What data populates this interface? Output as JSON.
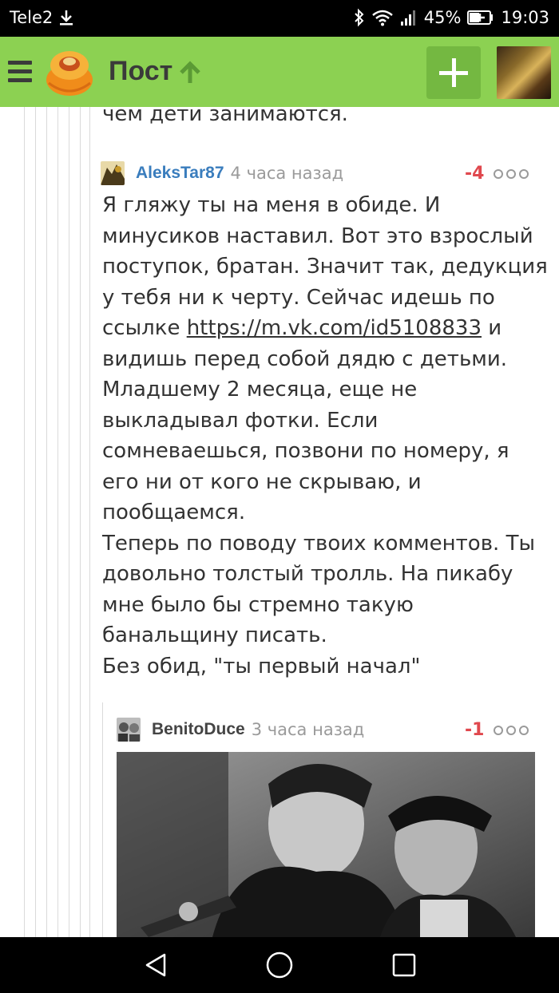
{
  "status_bar": {
    "carrier": "Tele2",
    "battery": "45%",
    "time": "19:03"
  },
  "header": {
    "title": "Пост",
    "add_label": "+"
  },
  "fragment_text": "чем дети занимаются.",
  "comments": [
    {
      "author": "AleksTar87",
      "time": "4 часа назад",
      "rating": "-4",
      "text_lines": [
        "Я гляжу ты на меня в обиде. И",
        "минусиков наставил.  Вот это взрослый",
        "поступок, братан. Значит так, дедукция",
        "у тебя ни к черту. Сейчас идешь по"
      ],
      "link_prefix": "ссылке ",
      "link": "https://m.vk.com/id5108833",
      "link_suffix": " и",
      "text_lines_2": [
        "видишь перед собой дядю с детьми.",
        "Младшему 2 месяца, еще не",
        "выкладывал фотки. Если",
        "сомневаешься, позвони по номеру, я",
        "его ни от кого не скрываю, и",
        "пообщаемся.",
        "Теперь по поводу твоих комментов. Ты",
        "довольно толстый тролль. На пикабу",
        "мне было бы стремно такую",
        "банальщину писать.",
        "Без обид, \"ты первый начал\""
      ]
    },
    {
      "author": "BenitoDuce",
      "time": "3 часа назад",
      "rating": "-1"
    }
  ],
  "colors": {
    "header_bg": "#8cd152",
    "add_button_bg": "#74b841",
    "author_link": "#3a7dbd",
    "rating_negative": "#e0484e"
  }
}
